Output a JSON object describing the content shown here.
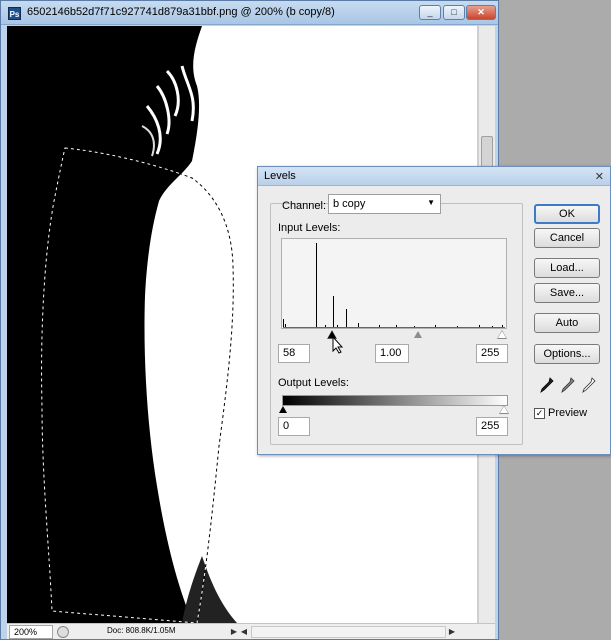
{
  "document": {
    "title": "6502146b52d7f71c927741d879a31bbf.png @ 200% (b copy/8)",
    "app_icon": "Ps",
    "window_buttons": {
      "minimize": "_",
      "maximize": "□",
      "close": "✕"
    },
    "zoom": "200%",
    "doc_info": "Doc: 808.8K/1.05M",
    "nav_left": "◀",
    "nav_right": "▶"
  },
  "levels": {
    "title": "Levels",
    "close": "✕",
    "channel_label": "Channel:",
    "channel_value": "b copy",
    "input_levels_label": "Input Levels:",
    "input_black": "58",
    "input_gamma": "1.00",
    "input_white": "255",
    "output_levels_label": "Output Levels:",
    "output_black": "0",
    "output_white": "255",
    "buttons": {
      "ok": "OK",
      "cancel": "Cancel",
      "load": "Load...",
      "save": "Save...",
      "auto": "Auto",
      "options": "Options..."
    },
    "preview_label": "Preview",
    "preview_checked": true,
    "eyedroppers": [
      "black-eyedropper-icon",
      "gray-eyedropper-icon",
      "white-eyedropper-icon"
    ]
  },
  "histogram": {
    "bins": [
      {
        "level": 0,
        "count": 10
      },
      {
        "level": 2,
        "count": 5
      },
      {
        "level": 38,
        "count": 100
      },
      {
        "level": 48,
        "count": 3
      },
      {
        "level": 58,
        "count": 38
      },
      {
        "level": 62,
        "count": 4
      },
      {
        "level": 72,
        "count": 22
      },
      {
        "level": 86,
        "count": 6
      },
      {
        "level": 110,
        "count": 3
      },
      {
        "level": 130,
        "count": 3
      },
      {
        "level": 150,
        "count": 2
      },
      {
        "level": 175,
        "count": 4
      },
      {
        "level": 200,
        "count": 2
      },
      {
        "level": 225,
        "count": 3
      },
      {
        "level": 240,
        "count": 2
      },
      {
        "level": 252,
        "count": 4
      }
    ],
    "max_level": 255
  }
}
